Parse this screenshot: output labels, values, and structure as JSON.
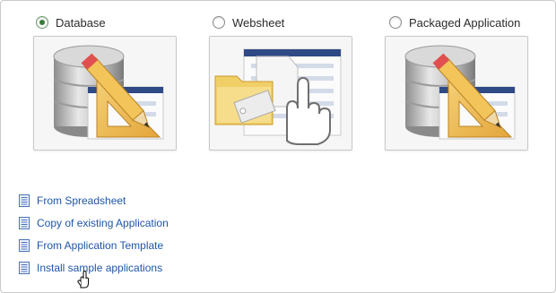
{
  "app_types": [
    {
      "label": "Database",
      "selected": true,
      "icon": "database-pencil-icon"
    },
    {
      "label": "Websheet",
      "selected": false,
      "icon": "websheet-hand-icon"
    },
    {
      "label": "Packaged Application",
      "selected": false,
      "icon": "database-pencil-icon"
    }
  ],
  "links": [
    {
      "label": "From Spreadsheet",
      "icon": "document-icon"
    },
    {
      "label": "Copy of existing Application",
      "icon": "document-icon"
    },
    {
      "label": "From Application Template",
      "icon": "document-icon"
    },
    {
      "label": "Install sample applications",
      "icon": "document-icon"
    }
  ],
  "colors": {
    "link": "#1f56a8",
    "selected_radio": "#3a7a3a",
    "tile_border": "#c8c8c8"
  }
}
